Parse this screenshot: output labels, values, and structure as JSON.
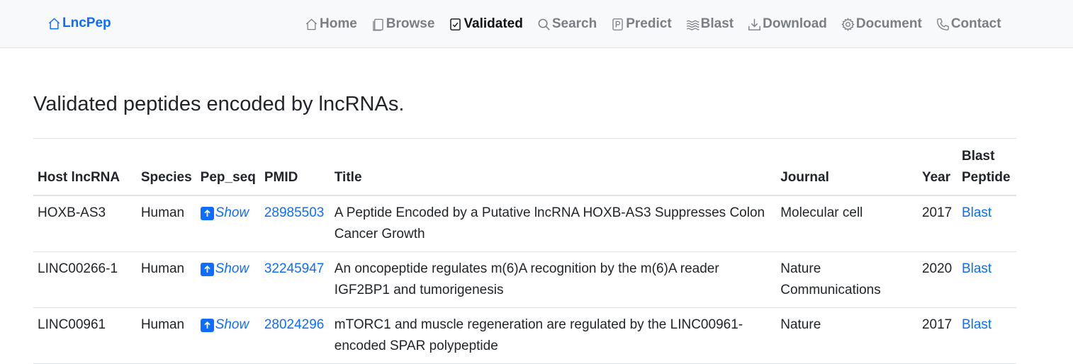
{
  "nav": {
    "brand": "LncPep",
    "items": [
      {
        "label": "Home",
        "icon": "house-icon",
        "active": false
      },
      {
        "label": "Browse",
        "icon": "journals-icon",
        "active": false
      },
      {
        "label": "Validated",
        "icon": "check-square-icon",
        "active": true
      },
      {
        "label": "Search",
        "icon": "search-icon",
        "active": false
      },
      {
        "label": "Predict",
        "icon": "p-square-icon",
        "active": false
      },
      {
        "label": "Blast",
        "icon": "water-icon",
        "active": false
      },
      {
        "label": "Download",
        "icon": "download-icon",
        "active": false
      },
      {
        "label": "Document",
        "icon": "gear-icon",
        "active": false
      },
      {
        "label": "Contact",
        "icon": "telephone-icon",
        "active": false
      }
    ]
  },
  "page_title": "Validated peptides encoded by lncRNAs.",
  "table": {
    "headers": {
      "host": "Host lncRNA",
      "species": "Species",
      "pep_seq": "Pep_seq",
      "pmid": "PMID",
      "title": "Title",
      "journal": "Journal",
      "year": "Year",
      "blast": "Blast Peptide"
    },
    "rows": [
      {
        "host": "HOXB-AS3",
        "species": "Human",
        "show": "Show",
        "pmid": "28985503",
        "title": "A Peptide Encoded by a Putative lncRNA HOXB-AS3 Suppresses Colon Cancer Growth",
        "journal": "Molecular cell",
        "year": "2017",
        "blast": "Blast"
      },
      {
        "host": "LINC00266-1",
        "species": "Human",
        "show": "Show",
        "pmid": "32245947",
        "title": "An oncopeptide regulates m(6)A recognition by the m(6)A reader IGF2BP1 and tumorigenesis",
        "journal": "Nature Communications",
        "year": "2020",
        "blast": "Blast"
      },
      {
        "host": "LINC00961",
        "species": "Human",
        "show": "Show",
        "pmid": "28024296",
        "title": "mTORC1 and muscle regeneration are regulated by the LINC00961-encoded SPAR polypeptide",
        "journal": "Nature",
        "year": "2017",
        "blast": "Blast"
      }
    ]
  },
  "colors": {
    "accent": "#0d6efd",
    "navbar_bg": "#f8f9fa",
    "nav_text": "#7a7f85"
  }
}
